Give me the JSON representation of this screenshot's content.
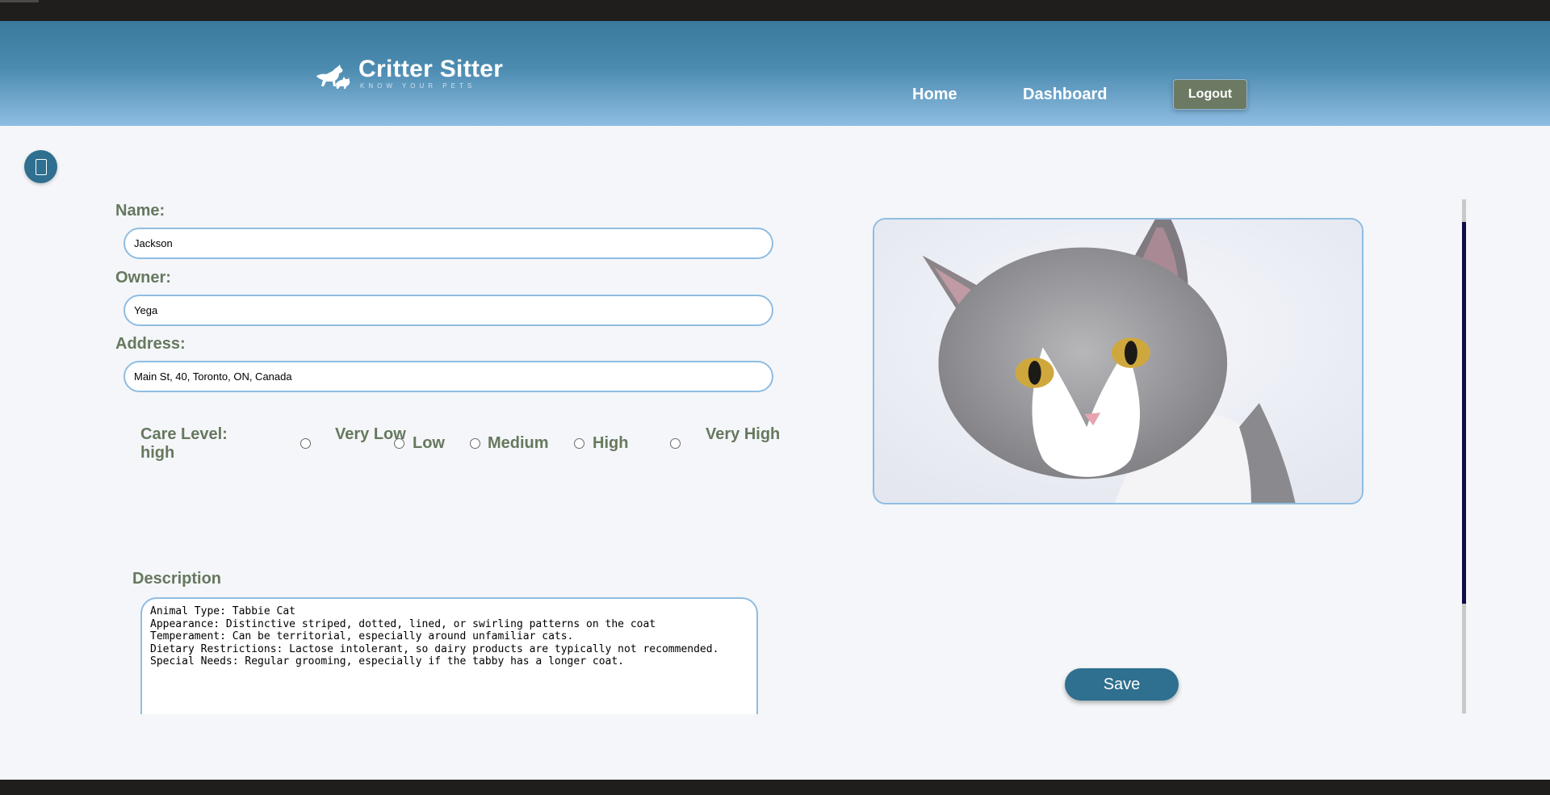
{
  "app": {
    "name": "Critter Sitter",
    "tagline": "KNOW YOUR PETS"
  },
  "nav": {
    "home": "Home",
    "dashboard": "Dashboard",
    "logout": "Logout"
  },
  "form": {
    "name_label": "Name:",
    "name_value": "Jackson",
    "owner_label": "Owner:",
    "owner_value": "Yega",
    "address_label": "Address:",
    "address_value": "Main St, 40, Toronto, ON, Canada",
    "care_level_label": "Care Level:",
    "care_level_value": "high",
    "care_options": [
      "Very Low",
      "Low",
      "Medium",
      "High",
      "Very High"
    ],
    "description_label": "Description",
    "description_value": "Animal Type: Tabbie Cat\nAppearance: Distinctive striped, dotted, lined, or swirling patterns on the coat\nTemperament: Can be territorial, especially around unfamiliar cats.\nDietary Restrictions: Lactose intolerant, so dairy products are typically not recommended.\nSpecial Needs: Regular grooming, especially if the tabby has a longer coat.",
    "save": "Save"
  },
  "icons": {
    "logo": "dog-cat-logo-icon",
    "sidebar_toggle": "sidebar-toggle-icon"
  },
  "colors": {
    "header_top": "#3a7a9c",
    "header_bottom": "#8fbde2",
    "accent": "#2f6f8f",
    "label": "#66785e",
    "logout_bg": "#6d7a63"
  }
}
